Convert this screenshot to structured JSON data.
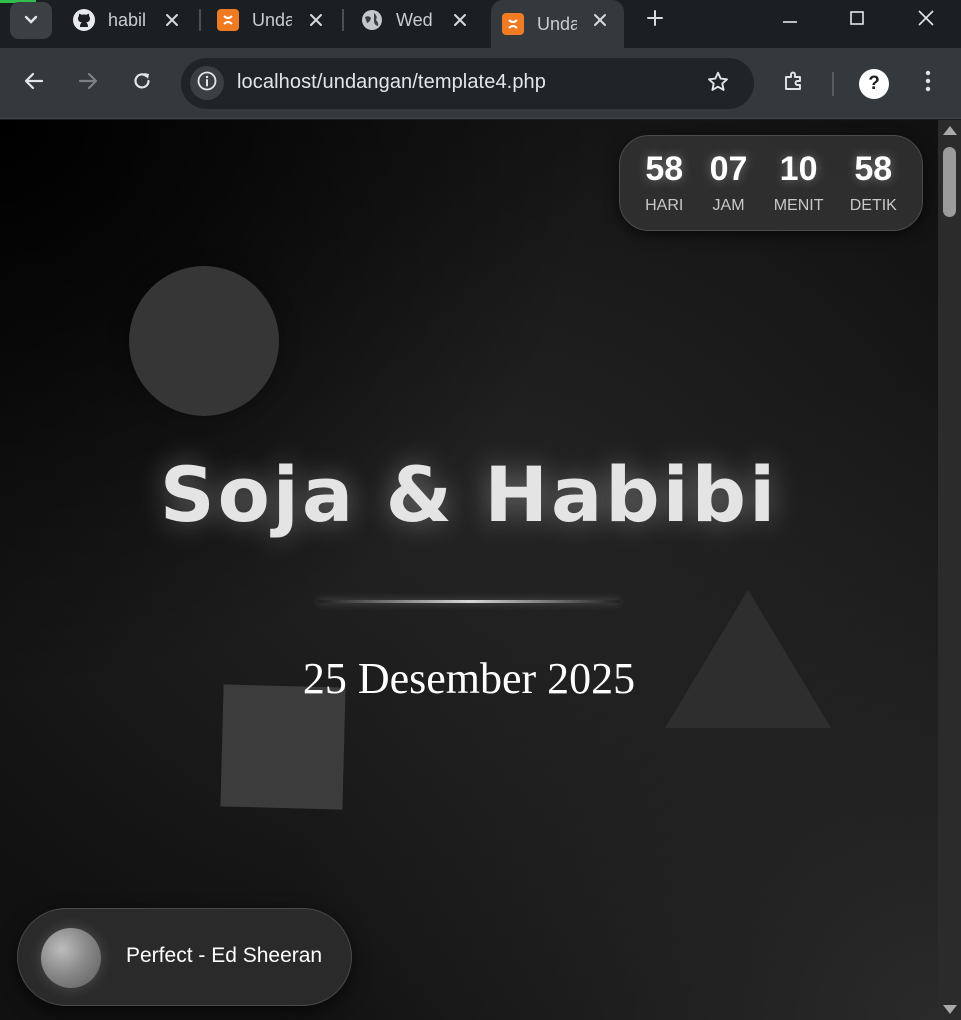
{
  "browser": {
    "tabs": [
      {
        "title": "habil",
        "favicon": "github-icon",
        "active": false
      },
      {
        "title": "Unda",
        "favicon": "xampp-icon",
        "active": false
      },
      {
        "title": "Wed",
        "favicon": "globe-icon",
        "active": false
      },
      {
        "title": "Unda",
        "favicon": "xampp-icon",
        "active": true
      }
    ],
    "url": "localhost/undangan/template4.php",
    "help_label": "?"
  },
  "countdown": {
    "days": {
      "value": "58",
      "label": "HARI"
    },
    "hours": {
      "value": "07",
      "label": "JAM"
    },
    "minutes": {
      "value": "10",
      "label": "MENIT"
    },
    "seconds": {
      "value": "58",
      "label": "DETIK"
    }
  },
  "hero": {
    "couple_names": "Soja & Habibi",
    "date": "25 Desember 2025"
  },
  "music": {
    "song": "Perfect - Ed Sheeran"
  },
  "colors": {
    "background": "#1c1c1c",
    "accent_glow": "#e4e4e4",
    "xampp_orange": "#f07b22"
  }
}
